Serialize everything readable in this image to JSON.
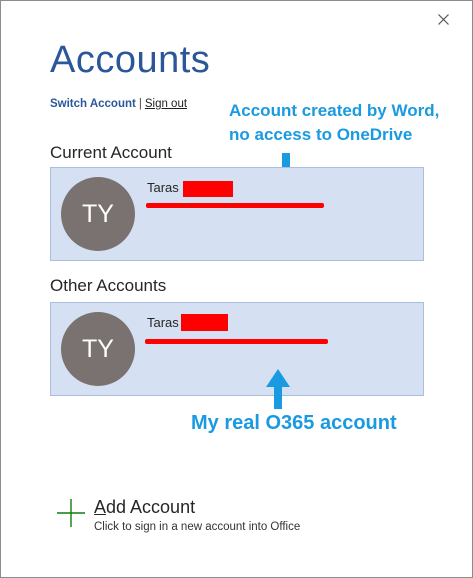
{
  "dialog": {
    "title": "Accounts",
    "close_icon": "close-icon"
  },
  "links": {
    "switch_account": "Switch Account",
    "separator": "|",
    "sign_out": "Sign out"
  },
  "annotations": {
    "top_line1": "Account created by Word,",
    "top_line2": "no access to OneDrive",
    "bottom": "My real O365 account",
    "color": "#1a9ae0"
  },
  "current_account": {
    "section_label": "Current Account",
    "initials": "TY",
    "name": "Taras"
  },
  "other_accounts": {
    "section_label": "Other Accounts",
    "items": [
      {
        "initials": "TY",
        "name": "Taras"
      }
    ]
  },
  "add_account": {
    "title_first_letter": "A",
    "title_rest": "dd Account",
    "subtitle": "Click to sign in a new account into Office",
    "icon": "plus-icon"
  },
  "colors": {
    "accent": "#2b579a",
    "card_bg": "#d5e1f2",
    "avatar_bg": "#797270",
    "redaction": "#ff0000",
    "plus": "#107c10"
  }
}
